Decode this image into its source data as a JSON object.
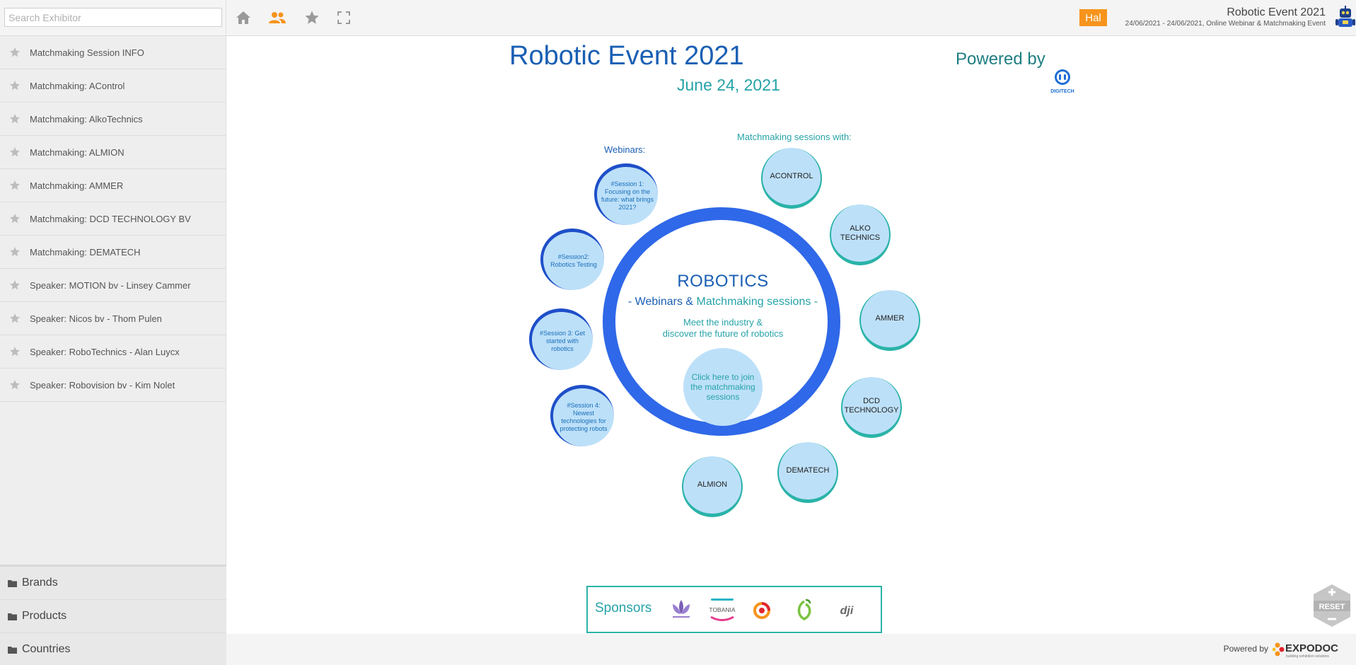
{
  "search": {
    "placeholder": "Search Exhibitor"
  },
  "toolbar": {
    "home_icon": "home-icon",
    "people_icon": "people-icon",
    "star_icon": "star-icon",
    "fullscreen_icon": "fullscreen-icon",
    "active_color": "#f7941d"
  },
  "user": {
    "name": "Hal",
    "badge_color": "#f7941d"
  },
  "event": {
    "title": "Robotic Event 2021",
    "subtitle": "24/06/2021 - 24/06/2021, Online Webinar & Matchmaking Event"
  },
  "sidebar": {
    "items": [
      {
        "label": "Matchmaking Session INFO"
      },
      {
        "label": "Matchmaking: AControl"
      },
      {
        "label": "Matchmaking: AlkoTechnics"
      },
      {
        "label": "Matchmaking: ALMION"
      },
      {
        "label": "Matchmaking: AMMER"
      },
      {
        "label": "Matchmaking: DCD TECHNOLOGY BV"
      },
      {
        "label": "Matchmaking: DEMATECH"
      },
      {
        "label": "Speaker: MOTION bv - Linsey Cammer"
      },
      {
        "label": "Speaker: Nicos bv - Thom Pulen"
      },
      {
        "label": "Speaker: RoboTechnics - Alan Luycx"
      },
      {
        "label": "Speaker: Robovision bv - Kim Nolet"
      }
    ],
    "footer": [
      {
        "label": "Brands"
      },
      {
        "label": "Products"
      },
      {
        "label": "Countries"
      }
    ]
  },
  "floorplan": {
    "title": "Robotic Event 2021",
    "date": "June 24, 2021",
    "powered_by": "Powered by",
    "powered_logo": "DIGITECH",
    "webinars_label": "Webinars:",
    "matchmaking_label": "Matchmaking sessions with:",
    "center": {
      "title": "ROBOTICS",
      "sub_prefix": "- Webinars & ",
      "sub_mm": "Matchmaking sessions -",
      "meet_line1": "Meet the industry &",
      "meet_line2": "discover the future of robotics",
      "join": "Click here to join the matchmaking sessions"
    },
    "webinars": [
      {
        "label": "#Session 1: Focusing on the future: what brings 2021?"
      },
      {
        "label": "#Session2: Robotics Testing"
      },
      {
        "label": "#Session 3: Get started with robotics"
      },
      {
        "label": "#Session 4: Newest technologies for protecting robots"
      }
    ],
    "matchmaking": [
      {
        "label": "ACONTROL"
      },
      {
        "label": "ALKO TECHNICS"
      },
      {
        "label": "AMMER"
      },
      {
        "label": "DCD TECHNOLOGY"
      },
      {
        "label": "DEMATECH"
      },
      {
        "label": "ALMION"
      }
    ],
    "sponsors_label": "Sponsors",
    "sponsors": [
      {
        "name": "TOBANIA"
      }
    ]
  },
  "footer": {
    "powered_by": "Powered by",
    "brand": "EXPODOC",
    "tagline": "building exhibition solutions"
  },
  "zoom": {
    "reset": "RESET"
  }
}
